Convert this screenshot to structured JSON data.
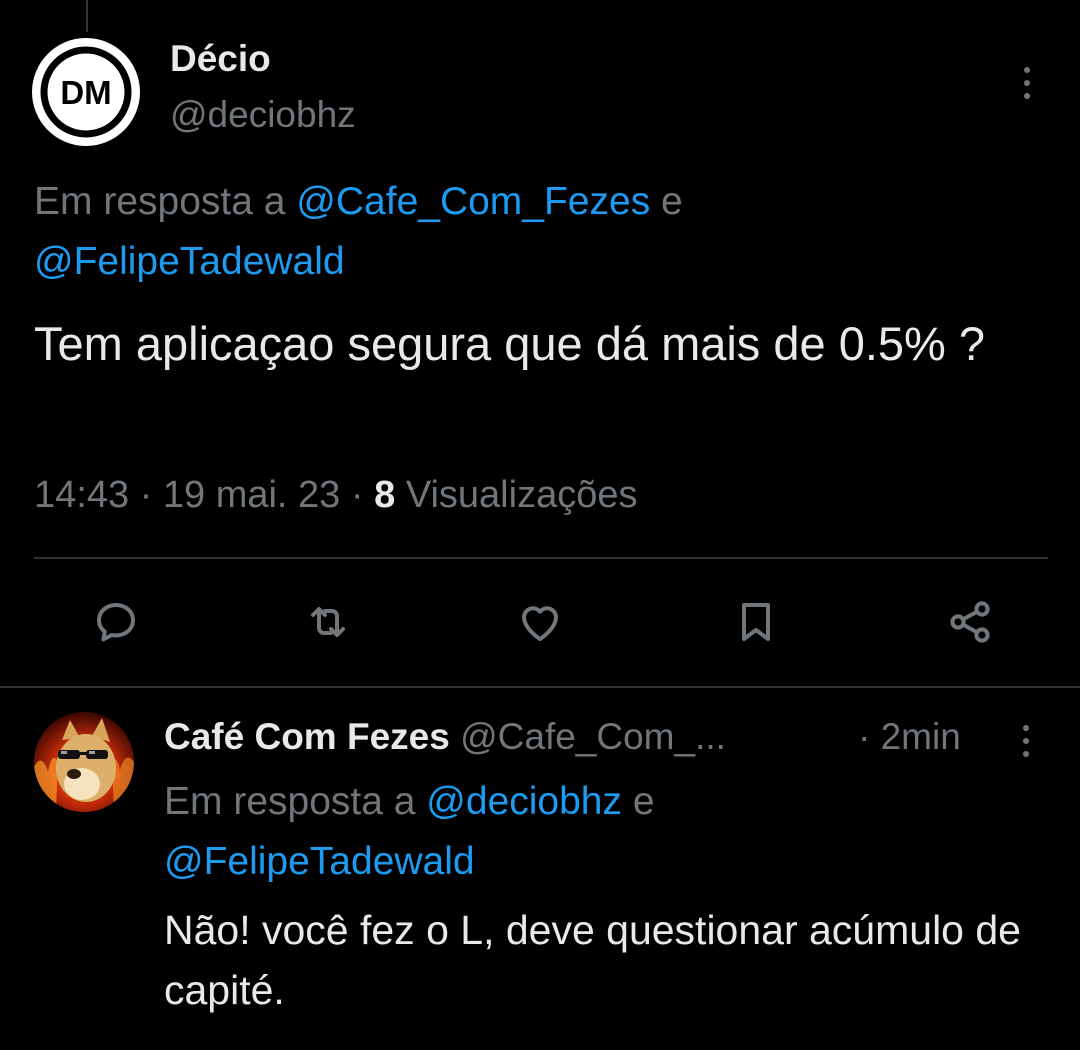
{
  "main_tweet": {
    "avatar_text": "DM",
    "author_name": "Décio",
    "author_handle": "@deciobhz",
    "reply_prefix": "Em resposta a",
    "reply_mention_1": "@Cafe_Com_Fezes",
    "reply_conjunction": "e",
    "reply_mention_2": "@FelipeTadewald",
    "text": "Tem aplicaçao segura que dá mais de 0.5% ?",
    "time": "14:43",
    "separator": "·",
    "date": "19 mai. 23",
    "views_count": "8",
    "views_label": "Visualizações"
  },
  "actions": [
    {
      "name": "reply",
      "icon": "speech-bubble-icon"
    },
    {
      "name": "retweet",
      "icon": "retweet-icon"
    },
    {
      "name": "like",
      "icon": "heart-icon"
    },
    {
      "name": "bookmark",
      "icon": "bookmark-icon"
    },
    {
      "name": "share",
      "icon": "share-icon"
    }
  ],
  "reply_tweet": {
    "author_name": "Café Com Fezes",
    "author_handle": "@Cafe_Com_...",
    "time": "· 2min",
    "reply_prefix": "Em resposta a",
    "reply_mention_1": "@deciobhz",
    "reply_conjunction": "e",
    "reply_mention_2": "@FelipeTadewald",
    "text": "Não! você fez o L, deve questionar acúmulo de capité."
  },
  "colors": {
    "background": "#000000",
    "text_primary": "#e7e9ea",
    "text_secondary": "#71767b",
    "link": "#1d9bf0",
    "divider": "#2f3336"
  }
}
